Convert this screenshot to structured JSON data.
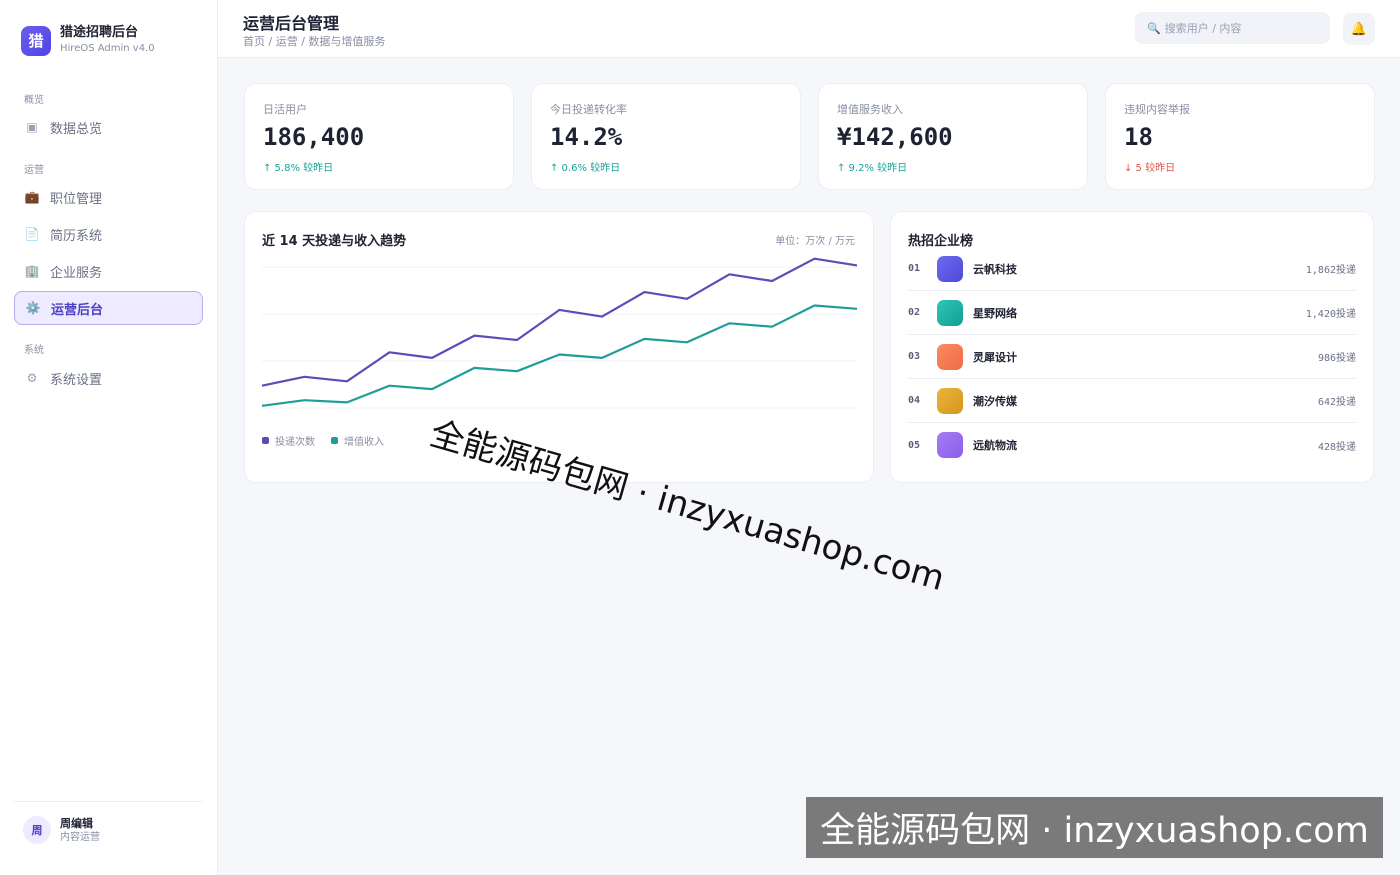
{
  "brand": {
    "logo_char": "猎",
    "name": "猎途招聘后台",
    "version": "HireOS Admin v4.0"
  },
  "sidebar": {
    "sections": [
      {
        "label": "概览"
      },
      {
        "label": "运营"
      },
      {
        "label": "系统"
      }
    ],
    "items": [
      {
        "label": "数据总览",
        "icon": "dashboard-icon",
        "glyph": "▣"
      },
      {
        "label": "职位管理",
        "icon": "briefcase-icon",
        "glyph": "💼"
      },
      {
        "label": "简历系统",
        "icon": "document-icon",
        "glyph": "📄"
      },
      {
        "label": "企业服务",
        "icon": "building-icon",
        "glyph": "🏢"
      },
      {
        "label": "运营后台",
        "icon": "gear-icon",
        "glyph": "⚙️",
        "active": true
      },
      {
        "label": "系统设置",
        "icon": "settings-icon",
        "glyph": "⚙"
      }
    ]
  },
  "user": {
    "avatar_char": "周",
    "name": "周编辑",
    "role": "内容运营"
  },
  "header": {
    "title": "运营后台管理",
    "breadcrumb": "首页 / 运营 / 数据与增值服务",
    "search_placeholder": "搜索用户 / 内容",
    "search_glyph": "🔍",
    "bell_glyph": "🔔"
  },
  "stats": [
    {
      "label": "日活用户",
      "value": "186,400",
      "delta": "↑ 5.8% 较昨日",
      "trend": "up"
    },
    {
      "label": "今日投递转化率",
      "value": "14.2%",
      "delta": "↑ 0.6% 较昨日",
      "trend": "up"
    },
    {
      "label": "增值服务收入",
      "value": "¥142,600",
      "delta": "↑ 9.2% 较昨日",
      "trend": "up"
    },
    {
      "label": "违规内容举报",
      "value": "18",
      "delta": "↓ 5 较昨日",
      "trend": "down"
    }
  ],
  "chart": {
    "title": "近 14 天投递与收入趋势",
    "unit": "单位：万次 / 万元"
  },
  "chart_data": {
    "type": "line",
    "x": [
      1,
      2,
      3,
      4,
      5,
      6,
      7,
      8,
      9,
      10,
      11,
      12,
      13,
      14
    ],
    "ylim": [
      0,
      140
    ],
    "grid": true,
    "legend_position": "bottom-left",
    "series": [
      {
        "name": "投递次数",
        "color": "#5b4db8",
        "values": [
          20,
          28,
          24,
          50,
          45,
          65,
          61,
          88,
          82,
          104,
          98,
          120,
          114,
          134,
          128
        ]
      },
      {
        "name": "增值收入",
        "color": "#1f9e98",
        "values": [
          2,
          7,
          5,
          20,
          17,
          36,
          33,
          48,
          45,
          62,
          59,
          76,
          73,
          92,
          89
        ]
      }
    ]
  },
  "ranking": {
    "title": "热招企业榜",
    "items": [
      {
        "rank": "01",
        "name": "云帆科技",
        "count": "1,862投递",
        "color": "#5b58e8"
      },
      {
        "rank": "02",
        "name": "星野网络",
        "count": "1,420投递",
        "color": "#1fb5a8"
      },
      {
        "rank": "03",
        "name": "灵犀设计",
        "count": "986投递",
        "color": "#f47c54"
      },
      {
        "rank": "04",
        "name": "潮汐传媒",
        "count": "642投递",
        "color": "#e0a62c"
      },
      {
        "rank": "05",
        "name": "远航物流",
        "count": "428投递",
        "color": "#9b6ff0"
      }
    ]
  },
  "watermark": {
    "text": "全能源码包网 · inzyxuashop.com"
  }
}
